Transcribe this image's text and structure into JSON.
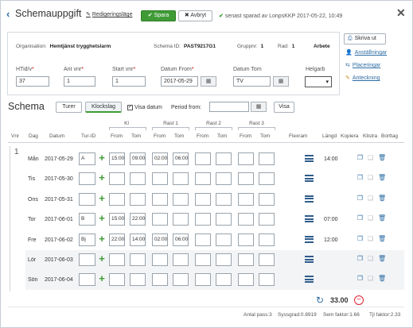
{
  "header": {
    "title": "Schemauppgift",
    "mode_label": "Redigeringsläge",
    "save_label": "Spara",
    "cancel_label": "Avbryt",
    "saved_text": "senast sparad av LonpsKKP 2017-05-22, 10:49"
  },
  "info": {
    "org_label": "Organisation:",
    "org_value": "Hemtjänst trygghetslarm",
    "schema_id_label": "Schema ID:",
    "schema_id_value": "PAST9217G1",
    "gruppnr_label": "Gruppnr:",
    "gruppnr_value": "1",
    "rad_label": "Rad:",
    "rad_value": "1",
    "type_value": "Arbete"
  },
  "fields": {
    "htid_label": "HTid/v",
    "htid_value": "37",
    "antvnr_label": "Ant vnr",
    "antvnr_value": "1",
    "startvnr_label": "Start vnr",
    "startvnr_value": "1",
    "datumfrom_label": "Datum From",
    "datumfrom_value": "2017-05-29",
    "datumtom_label": "Datum Tom",
    "datumtom_value": "TV",
    "helgarb_label": "Helgarb",
    "helgarb_value": ""
  },
  "side": {
    "print_label": "Skriva ut",
    "links": [
      "Anställningar",
      "Placeringar",
      "Anteckning"
    ]
  },
  "schema": {
    "title": "Schema",
    "tab_turer": "Turer",
    "tab_klockslag": "Klockslag",
    "visa_datum_label": "Visa datum",
    "visa_datum_checked": true,
    "period_from_label": "Period from:",
    "period_from_value": "",
    "visa_label": "Visa"
  },
  "table": {
    "group_headers": [
      "Kl",
      "Rast 1",
      "Rast 2",
      "Rast 3"
    ],
    "columns": [
      "Vnr",
      "Dag",
      "Datum",
      "Tur-ID",
      "From",
      "Tom",
      "From",
      "Tom",
      "From",
      "Tom",
      "From",
      "Tom",
      "Flexram",
      "Längd",
      "Kopiera",
      "Klistra",
      "Borttag"
    ],
    "vnr": "1",
    "rows": [
      {
        "day": "Mån",
        "date": "2017-05-29",
        "turid": "A",
        "kl_from": "15:00",
        "kl_tom": "09:00",
        "r1_from": "02:00",
        "r1_tom": "06:00",
        "r2_from": "",
        "r2_tom": "",
        "r3_from": "",
        "r3_tom": "",
        "langd": "14:00"
      },
      {
        "day": "Tis",
        "date": "2017-05-30",
        "turid": "",
        "kl_from": "",
        "kl_tom": "",
        "r1_from": "",
        "r1_tom": "",
        "r2_from": "",
        "r2_tom": "",
        "r3_from": "",
        "r3_tom": "",
        "langd": ""
      },
      {
        "day": "Ons",
        "date": "2017-05-31",
        "turid": "",
        "kl_from": "",
        "kl_tom": "",
        "r1_from": "",
        "r1_tom": "",
        "r2_from": "",
        "r2_tom": "",
        "r3_from": "",
        "r3_tom": "",
        "langd": ""
      },
      {
        "day": "Tor",
        "date": "2017-06-01",
        "turid": "B",
        "kl_from": "15:00",
        "kl_tom": "22:00",
        "r1_from": "",
        "r1_tom": "",
        "r2_from": "",
        "r2_tom": "",
        "r3_from": "",
        "r3_tom": "",
        "langd": "07:00"
      },
      {
        "day": "Fre",
        "date": "2017-06-02",
        "turid": "Bj",
        "kl_from": "22:00",
        "kl_tom": "14:00",
        "r1_from": "02:00",
        "r1_tom": "06:00",
        "r2_from": "",
        "r2_tom": "",
        "r3_from": "",
        "r3_tom": "",
        "langd": "12:00"
      },
      {
        "day": "Lör",
        "date": "2017-06-03",
        "turid": "",
        "kl_from": "",
        "kl_tom": "",
        "r1_from": "",
        "r1_tom": "",
        "r2_from": "",
        "r2_tom": "",
        "r3_from": "",
        "r3_tom": "",
        "langd": ""
      },
      {
        "day": "Sön",
        "date": "2017-06-04",
        "turid": "",
        "kl_from": "",
        "kl_tom": "",
        "r1_from": "",
        "r1_tom": "",
        "r2_from": "",
        "r2_tom": "",
        "r3_from": "",
        "r3_tom": "",
        "langd": ""
      }
    ]
  },
  "footer": {
    "total": "33.00",
    "antal_pass": "Antal pass:3",
    "syssgrad": "Syssgrad:0.8919",
    "sem_faktor": "Sem faktor:1.66",
    "tjl_faktor": "Tjl faktor:2.33"
  },
  "colors": {
    "accent_green": "#3f9b35",
    "link_blue": "#2e6da4",
    "danger_red": "#dd2233"
  }
}
